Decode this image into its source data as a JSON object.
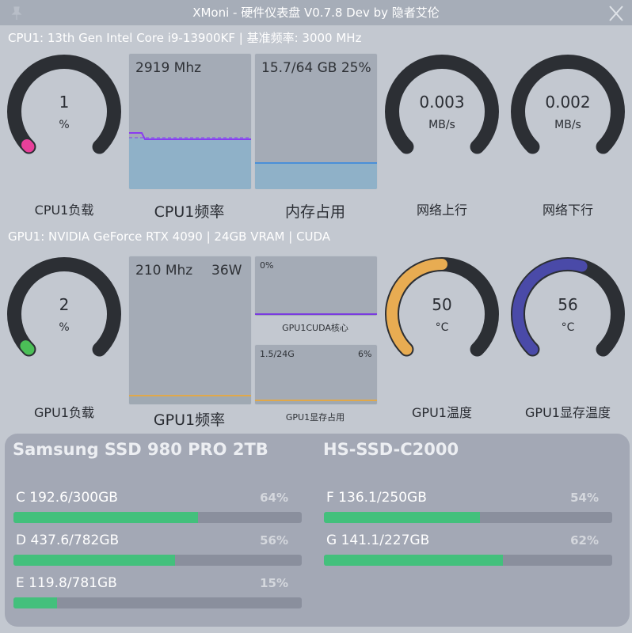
{
  "window": {
    "title": "XMoni - 硬件仪表盘 V0.7.8   Dev by 隐者艾伦"
  },
  "cpu": {
    "info": "CPU1: 13th Gen Intel Core i9-13900KF   |  基准频率:  3000 MHz",
    "load": {
      "value": "1",
      "unit": "%",
      "label": "CPU1负载",
      "fraction": 0.01,
      "color": "#e8409a"
    },
    "freq": {
      "text": "2919 Mhz",
      "label": "CPU1频率",
      "fill_fraction": 0.38
    },
    "mem": {
      "text": "15.7/64 GB 25%",
      "label": "内存占用",
      "fill_fraction": 0.25
    }
  },
  "net": {
    "up": {
      "value": "0.003",
      "unit": "MB/s",
      "label": "网络上行"
    },
    "down": {
      "value": "0.002",
      "unit": "MB/s",
      "label": "网络下行"
    }
  },
  "gpu": {
    "info": "GPU1: NVIDIA GeForce RTX 4090  |  24GB VRAM  |  CUDA",
    "load": {
      "value": "2",
      "unit": "%",
      "label": "GPU1负载",
      "fraction": 0.02,
      "color": "#4bbf57"
    },
    "freq": {
      "text": "210 Mhz",
      "power": "36W",
      "label": "GPU1频率"
    },
    "cuda": {
      "pct": "0%",
      "label": "GPU1CUDA核心"
    },
    "vram": {
      "text": "1.5/24G",
      "pct": "6%",
      "label": "GPU1显存占用"
    },
    "temp": {
      "value": "50",
      "unit": "°C",
      "label": "GPU1温度",
      "fraction": 0.5,
      "color": "#e8ac52"
    },
    "vram_temp": {
      "value": "56",
      "unit": "°C",
      "label": "GPU1显存温度",
      "fraction": 0.56,
      "color": "#4a4aa8"
    }
  },
  "disks": [
    {
      "title": "Samsung SSD 980 PRO 2TB",
      "partitions": [
        {
          "label": "C  192.6/300GB",
          "pct": "64%",
          "fraction": 0.64
        },
        {
          "label": "D  437.6/782GB",
          "pct": "56%",
          "fraction": 0.56
        },
        {
          "label": "E  119.8/781GB",
          "pct": "15%",
          "fraction": 0.15
        }
      ]
    },
    {
      "title": "HS-SSD-C2000",
      "partitions": [
        {
          "label": "F  136.1/250GB",
          "pct": "54%",
          "fraction": 0.54
        },
        {
          "label": "G  141.1/227GB",
          "pct": "62%",
          "fraction": 0.62
        }
      ]
    }
  ],
  "icons": {
    "close": "close-icon",
    "pin": "pin-icon"
  }
}
